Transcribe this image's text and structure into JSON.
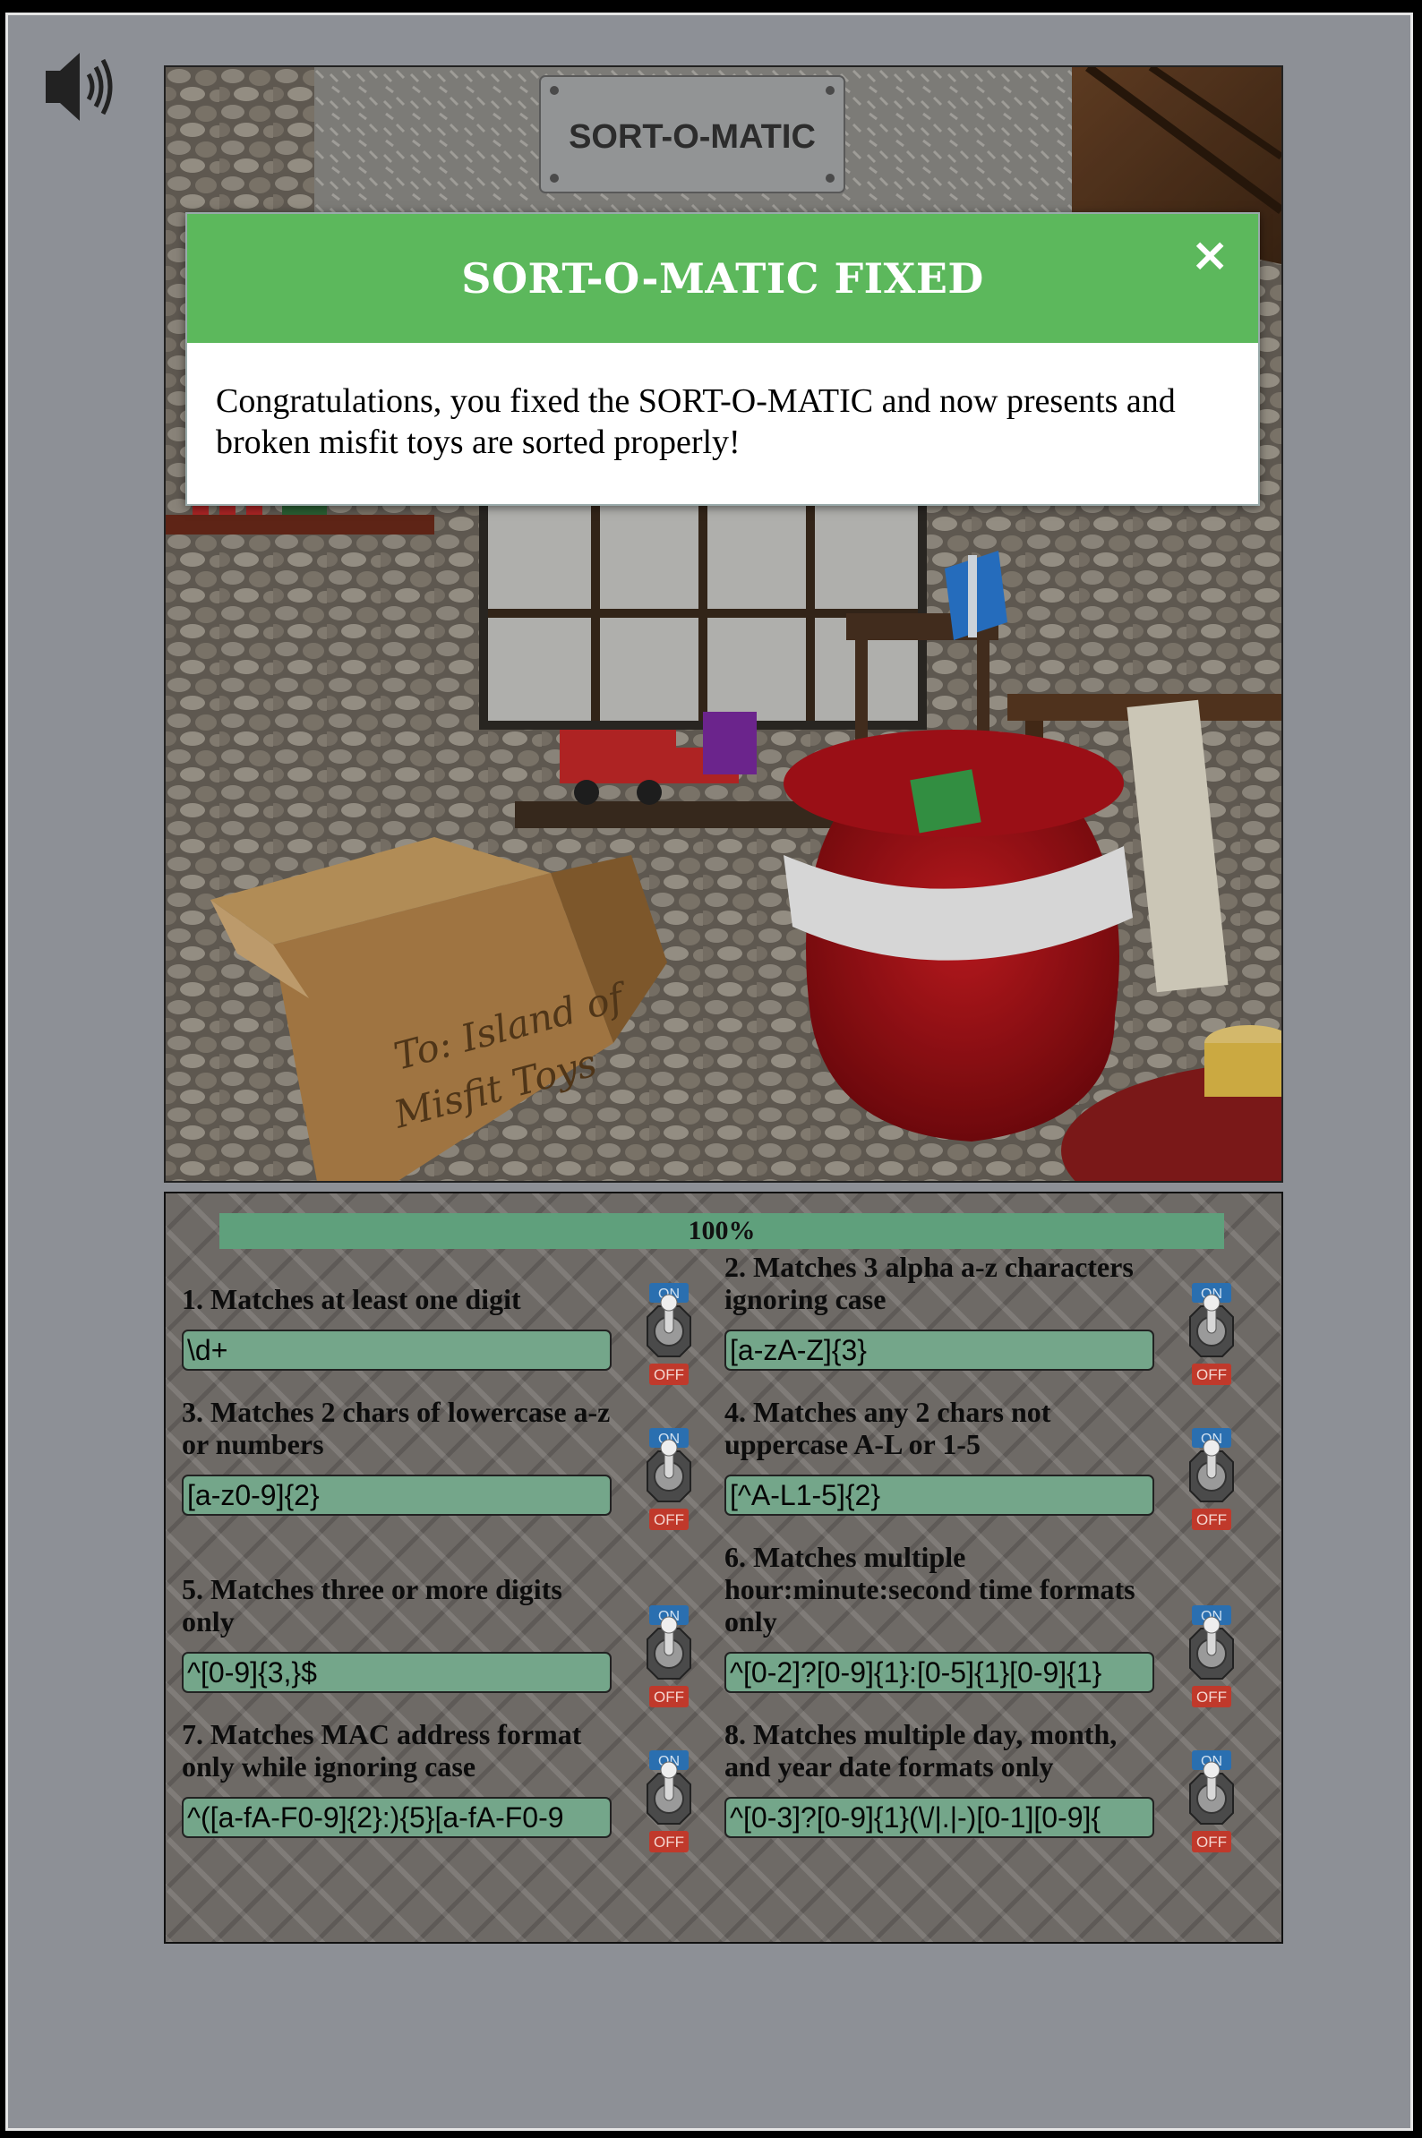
{
  "sound": {
    "icon": "speaker-icon"
  },
  "scene": {
    "sign": "SORT-O-MATIC",
    "box_text_line1": "To: Island of",
    "box_text_line2": "Misfit Toys"
  },
  "modal": {
    "title": "SORT-O-MATIC FIXED",
    "close_label": "×",
    "message": "Congratulations, you fixed the SORT-O-MATIC and now presents and broken misfit toys are sorted properly!"
  },
  "panel": {
    "progress": {
      "percent": 100,
      "label": "100%"
    },
    "rules": [
      {
        "label": "1. Matches at least one digit",
        "value": "\\d+"
      },
      {
        "label": "2. Matches 3 alpha a-z characters ignoring case",
        "value": "[a-zA-Z]{3}"
      },
      {
        "label": "3. Matches 2 chars of lowercase a-z or numbers",
        "value": "[a-z0-9]{2}"
      },
      {
        "label": "4. Matches any 2 chars not uppercase A-L or 1-5",
        "value": "[^A-L1-5]{2}"
      },
      {
        "label": "5. Matches three or more digits only",
        "value": "^[0-9]{3,}$"
      },
      {
        "label": "6. Matches multiple hour:minute:second time formats only",
        "value": "^[0-2]?[0-9]{1}:[0-5]{1}[0-9]{1}"
      },
      {
        "label": "7. Matches MAC address format only while ignoring case",
        "value": "^([a-fA-F0-9]{2}:){5}[a-fA-F0-9"
      },
      {
        "label": "8. Matches multiple day, month, and year date formats only",
        "value": "^[0-3]?[0-9]{1}(\\/|.|-)[0-1][0-9]{"
      }
    ],
    "toggle": {
      "on_label": "ON",
      "off_label": "OFF",
      "state": "on"
    }
  },
  "colors": {
    "modal_header": "#5cb85c",
    "progress": "#5fa07c",
    "input_bg": "#74a68a",
    "off_label": "#c0392b",
    "on_label": "#2a6fb0"
  }
}
